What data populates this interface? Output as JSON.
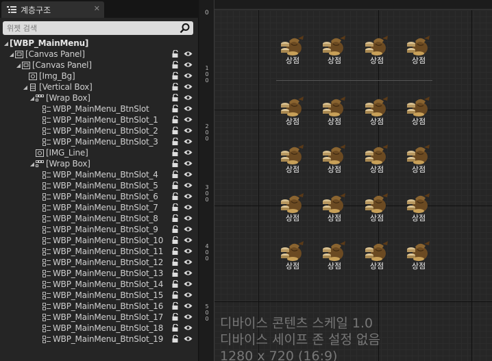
{
  "hierarchy": {
    "tab_label": "계층구조",
    "search_placeholder": "위젯 검색",
    "items": [
      {
        "label": "[WBP_MainMenu]",
        "depth": 0,
        "arrow": "",
        "icon": "none"
      },
      {
        "label": "[Canvas Panel]",
        "depth": 1,
        "arrow": "◢",
        "icon": "canvas"
      },
      {
        "label": "[Canvas Panel]",
        "depth": 2,
        "arrow": "◢",
        "icon": "canvas"
      },
      {
        "label": "[Img_Bg]",
        "depth": 3,
        "arrow": "",
        "icon": "image"
      },
      {
        "label": "[Vertical Box]",
        "depth": 3,
        "arrow": "◢",
        "icon": "vbox"
      },
      {
        "label": "[Wrap Box]",
        "depth": 4,
        "arrow": "◢",
        "icon": "wrap"
      },
      {
        "label": "WBP_MainMenu_BtnSlot",
        "depth": 5,
        "arrow": "",
        "icon": "widget"
      },
      {
        "label": "WBP_MainMenu_BtnSlot_1",
        "depth": 5,
        "arrow": "",
        "icon": "widget"
      },
      {
        "label": "WBP_MainMenu_BtnSlot_2",
        "depth": 5,
        "arrow": "",
        "icon": "widget"
      },
      {
        "label": "WBP_MainMenu_BtnSlot_3",
        "depth": 5,
        "arrow": "",
        "icon": "widget"
      },
      {
        "label": "[IMG_Line]",
        "depth": 4,
        "arrow": "",
        "icon": "image"
      },
      {
        "label": "[Wrap Box]",
        "depth": 4,
        "arrow": "◢",
        "icon": "wrap"
      },
      {
        "label": "WBP_MainMenu_BtnSlot_4",
        "depth": 5,
        "arrow": "",
        "icon": "widget"
      },
      {
        "label": "WBP_MainMenu_BtnSlot_5",
        "depth": 5,
        "arrow": "",
        "icon": "widget"
      },
      {
        "label": "WBP_MainMenu_BtnSlot_6",
        "depth": 5,
        "arrow": "",
        "icon": "widget"
      },
      {
        "label": "WBP_MainMenu_BtnSlot_7",
        "depth": 5,
        "arrow": "",
        "icon": "widget"
      },
      {
        "label": "WBP_MainMenu_BtnSlot_8",
        "depth": 5,
        "arrow": "",
        "icon": "widget"
      },
      {
        "label": "WBP_MainMenu_BtnSlot_9",
        "depth": 5,
        "arrow": "",
        "icon": "widget"
      },
      {
        "label": "WBP_MainMenu_BtnSlot_10",
        "depth": 5,
        "arrow": "",
        "icon": "widget"
      },
      {
        "label": "WBP_MainMenu_BtnSlot_11",
        "depth": 5,
        "arrow": "",
        "icon": "widget"
      },
      {
        "label": "WBP_MainMenu_BtnSlot_12",
        "depth": 5,
        "arrow": "",
        "icon": "widget"
      },
      {
        "label": "WBP_MainMenu_BtnSlot_13",
        "depth": 5,
        "arrow": "",
        "icon": "widget"
      },
      {
        "label": "WBP_MainMenu_BtnSlot_14",
        "depth": 5,
        "arrow": "",
        "icon": "widget"
      },
      {
        "label": "WBP_MainMenu_BtnSlot_15",
        "depth": 5,
        "arrow": "",
        "icon": "widget"
      },
      {
        "label": "WBP_MainMenu_BtnSlot_16",
        "depth": 5,
        "arrow": "",
        "icon": "widget"
      },
      {
        "label": "WBP_MainMenu_BtnSlot_17",
        "depth": 5,
        "arrow": "",
        "icon": "widget"
      },
      {
        "label": "WBP_MainMenu_BtnSlot_18",
        "depth": 5,
        "arrow": "",
        "icon": "widget"
      },
      {
        "label": "WBP_MainMenu_BtnSlot_19",
        "depth": 5,
        "arrow": "",
        "icon": "widget"
      }
    ]
  },
  "canvas": {
    "ruler_top_zero": "0",
    "ruler_left": [
      "1 0 0",
      "2 0 0",
      "3 0 0",
      "4 0 0",
      "5 0 0"
    ],
    "slot_label": "상점",
    "slot_icon": "item-bag-icon",
    "info_lines": [
      "디바이스 콘텐츠 스케일 1.0",
      "디바이스 세이프 존 설정 없음",
      "1280 x 720 (16:9)"
    ]
  },
  "colors": {
    "panel_bg": "#252525",
    "canvas_bg": "#262626",
    "search_bg": "#dcdcdc",
    "slot_label": "#eeeeee",
    "info_text": "#777777"
  }
}
